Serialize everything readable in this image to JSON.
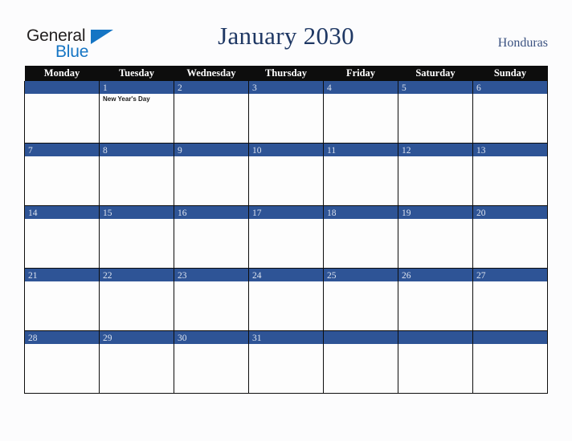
{
  "brand": {
    "name_part1": "General",
    "name_part2": "Blue",
    "triangle_icon": "triangle-icon",
    "color_dark": "#221f1f",
    "color_blue": "#1575c4"
  },
  "header": {
    "title": "January 2030",
    "country": "Honduras",
    "title_color": "#1f3864"
  },
  "calendar": {
    "weekday_headers": [
      "Monday",
      "Tuesday",
      "Wednesday",
      "Thursday",
      "Friday",
      "Saturday",
      "Sunday"
    ],
    "header_bg": "#0d0d0d",
    "daybar_bg": "#2e5496",
    "weeks": [
      [
        {
          "day": "",
          "events": []
        },
        {
          "day": "1",
          "events": [
            "New Year's Day"
          ]
        },
        {
          "day": "2",
          "events": []
        },
        {
          "day": "3",
          "events": []
        },
        {
          "day": "4",
          "events": []
        },
        {
          "day": "5",
          "events": []
        },
        {
          "day": "6",
          "events": []
        }
      ],
      [
        {
          "day": "7",
          "events": []
        },
        {
          "day": "8",
          "events": []
        },
        {
          "day": "9",
          "events": []
        },
        {
          "day": "10",
          "events": []
        },
        {
          "day": "11",
          "events": []
        },
        {
          "day": "12",
          "events": []
        },
        {
          "day": "13",
          "events": []
        }
      ],
      [
        {
          "day": "14",
          "events": []
        },
        {
          "day": "15",
          "events": []
        },
        {
          "day": "16",
          "events": []
        },
        {
          "day": "17",
          "events": []
        },
        {
          "day": "18",
          "events": []
        },
        {
          "day": "19",
          "events": []
        },
        {
          "day": "20",
          "events": []
        }
      ],
      [
        {
          "day": "21",
          "events": []
        },
        {
          "day": "22",
          "events": []
        },
        {
          "day": "23",
          "events": []
        },
        {
          "day": "24",
          "events": []
        },
        {
          "day": "25",
          "events": []
        },
        {
          "day": "26",
          "events": []
        },
        {
          "day": "27",
          "events": []
        }
      ],
      [
        {
          "day": "28",
          "events": []
        },
        {
          "day": "29",
          "events": []
        },
        {
          "day": "30",
          "events": []
        },
        {
          "day": "31",
          "events": []
        },
        {
          "day": "",
          "events": []
        },
        {
          "day": "",
          "events": []
        },
        {
          "day": "",
          "events": []
        }
      ]
    ]
  }
}
